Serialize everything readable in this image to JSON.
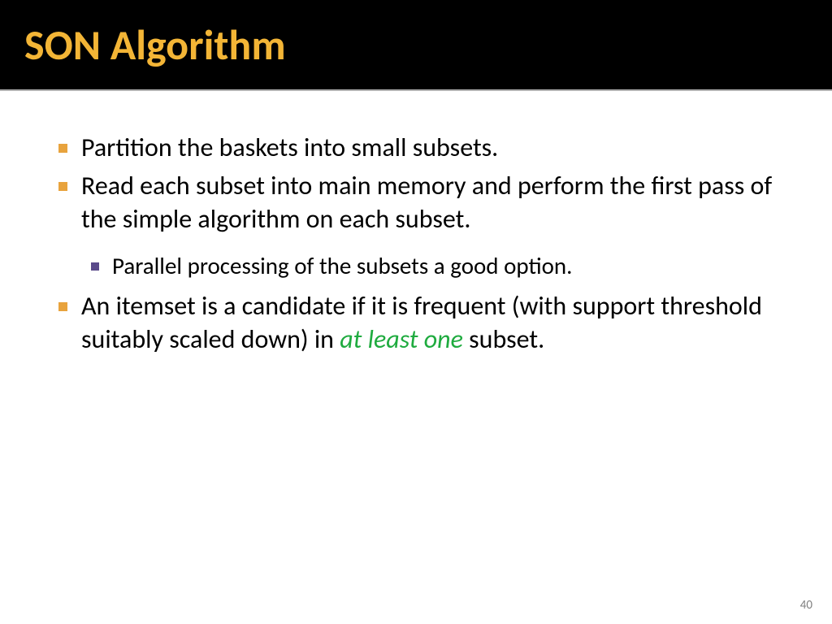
{
  "title": "SON Algorithm",
  "bullets": [
    {
      "text": "Partition the baskets into small subsets."
    },
    {
      "text": "Read each subset into main memory and perform the first pass of the simple algorithm on each subset.",
      "sub": [
        {
          "text": "Parallel processing of the subsets a good option."
        }
      ]
    },
    {
      "segments": [
        {
          "text": "An itemset is a candidate if it is frequent (with support threshold suitably scaled down) in ",
          "em": false
        },
        {
          "text": "at least one",
          "em": true
        },
        {
          "text": " subset.",
          "em": false
        }
      ]
    }
  ],
  "page_number": "40"
}
